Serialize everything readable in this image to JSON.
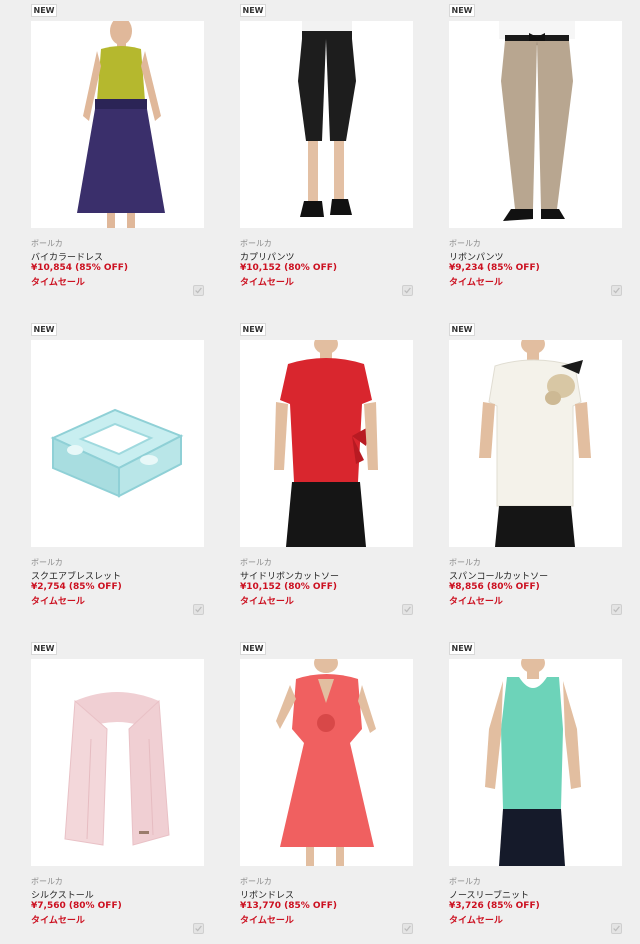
{
  "products": [
    {
      "badge": "NEW",
      "brand": "ボールカ",
      "name": "バイカラードレス",
      "price": "¥10,854 (85% OFF)",
      "sale": "タイムセール",
      "image": "two-tone-dress-photo"
    },
    {
      "badge": "NEW",
      "brand": "ボールカ",
      "name": "カプリパンツ",
      "price": "¥10,152 (80% OFF)",
      "sale": "タイムセール",
      "image": "capri-pants-photo"
    },
    {
      "badge": "NEW",
      "brand": "ボールカ",
      "name": "リボンパンツ",
      "price": "¥9,234 (85% OFF)",
      "sale": "タイムセール",
      "image": "ribbon-pants-photo"
    },
    {
      "badge": "NEW",
      "brand": "ボールカ",
      "name": "スクエアブレスレット",
      "price": "¥2,754 (85% OFF)",
      "sale": "タイムセール",
      "image": "square-bracelet-photo"
    },
    {
      "badge": "NEW",
      "brand": "ボールカ",
      "name": "サイドリボンカットソー",
      "price": "¥10,152 (80% OFF)",
      "sale": "タイムセール",
      "image": "side-ribbon-top-photo"
    },
    {
      "badge": "NEW",
      "brand": "ボールカ",
      "name": "スパンコールカットソー",
      "price": "¥8,856 (80% OFF)",
      "sale": "タイムセール",
      "image": "sequin-top-photo"
    },
    {
      "badge": "NEW",
      "brand": "ボールカ",
      "name": "シルクストール",
      "price": "¥7,560 (80% OFF)",
      "sale": "タイムセール",
      "image": "silk-stole-photo"
    },
    {
      "badge": "NEW",
      "brand": "ボールカ",
      "name": "リボンドレス",
      "price": "¥13,770 (85% OFF)",
      "sale": "タイムセール",
      "image": "ribbon-dress-photo"
    },
    {
      "badge": "NEW",
      "brand": "ボールカ",
      "name": "ノースリーブニット",
      "price": "¥3,726 (85% OFF)",
      "sale": "タイムセール",
      "image": "sleeveless-knit-photo"
    }
  ],
  "colors": {
    "price": "#cc1020",
    "background": "#efefef",
    "dress_top": "#b5b82e",
    "dress_skirt": "#3a2f6b",
    "capri": "#1d1d1d",
    "ribbon_pants": "#b8a690",
    "bracelet": "#a8dde0",
    "red_top": "#d9262e",
    "cream_top": "#f4f2ea",
    "stole": "#f0cfd3",
    "coral_dress": "#f06060",
    "mint_knit": "#6dd3b9"
  },
  "icons": {
    "checkbox": "checkmark-icon"
  }
}
